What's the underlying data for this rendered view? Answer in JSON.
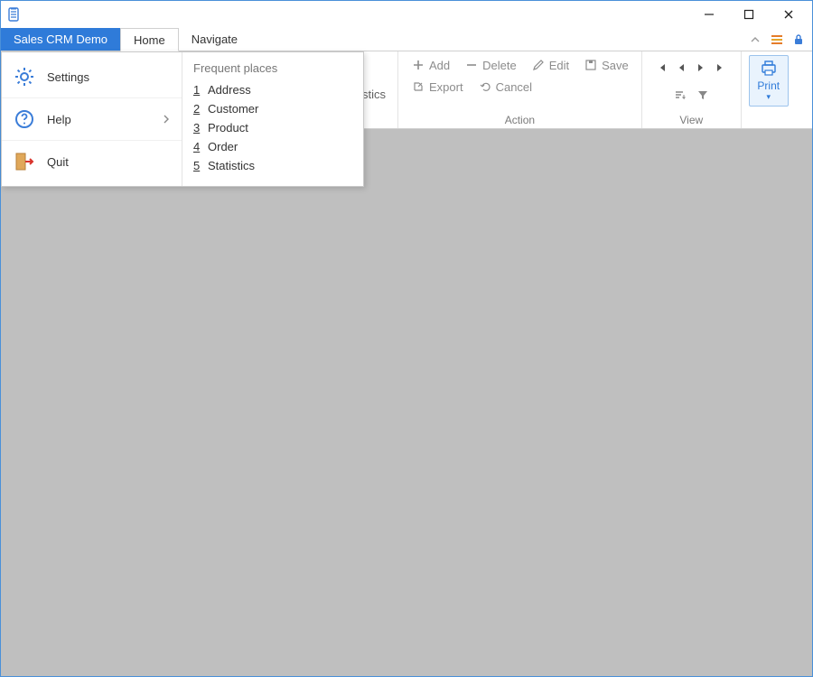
{
  "window": {
    "app_title": "Sales CRM Demo"
  },
  "menubar": {
    "app_tab": "Sales CRM Demo",
    "tabs": [
      "Home",
      "Navigate"
    ]
  },
  "app_menu": {
    "left": {
      "settings": "Settings",
      "help": "Help",
      "quit": "Quit"
    },
    "right": {
      "heading": "Frequent places",
      "places": [
        {
          "num": "1",
          "label": "Address"
        },
        {
          "num": "2",
          "label": "Customer"
        },
        {
          "num": "3",
          "label": "Product"
        },
        {
          "num": "4",
          "label": "Order"
        },
        {
          "num": "5",
          "label": "Statistics"
        }
      ]
    }
  },
  "ribbon": {
    "peek_label_top": "",
    "peek_label_stics": "stics",
    "action": {
      "add": "Add",
      "delete": "Delete",
      "edit": "Edit",
      "save": "Save",
      "export": "Export",
      "cancel": "Cancel",
      "group_label": "Action"
    },
    "view": {
      "group_label": "View"
    },
    "print": {
      "label": "Print"
    }
  }
}
